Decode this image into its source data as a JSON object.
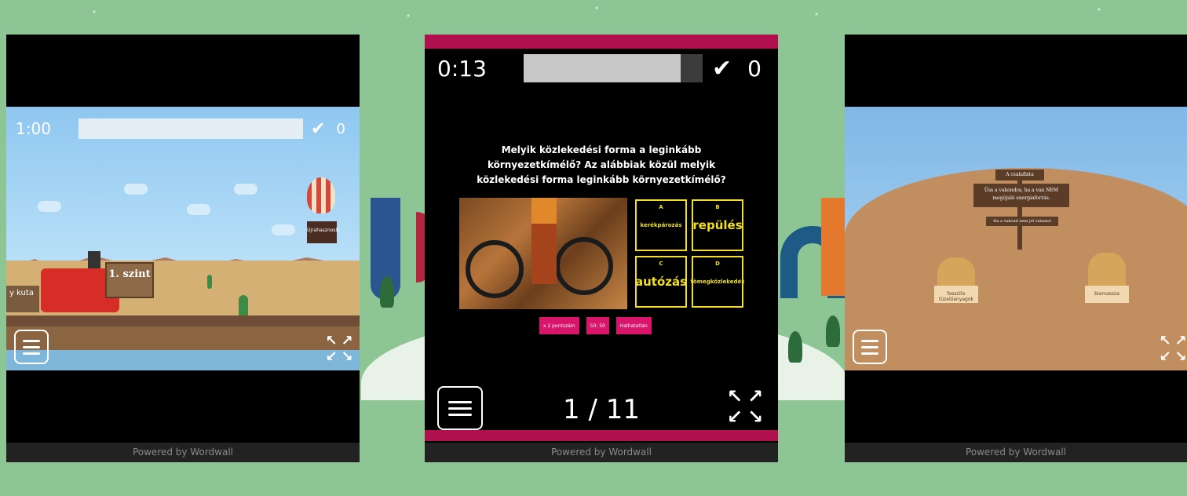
{
  "left": {
    "timer": "1:00",
    "score": "0",
    "level_sign": "1. szint",
    "wagon_label": "y kuta",
    "balloon_label": "Újrahasznosít",
    "powered": "Powered by Wordwall"
  },
  "middle": {
    "timer": "0:13",
    "score": "0",
    "question": "Melyik közlekedési forma a leginkább környezetkímélő? Az alábbiak közül melyik közlekedési forma leginkább környezetkímélő?",
    "answers": [
      {
        "letter": "A",
        "text": "kerékpározás"
      },
      {
        "letter": "B",
        "text": "repülés"
      },
      {
        "letter": "C",
        "text": "autózás"
      },
      {
        "letter": "D",
        "text": "tömegközlekedés"
      }
    ],
    "powerups": [
      "x 2 pontszám",
      "50: 50",
      "Halhatatlan"
    ],
    "pager": "1 / 11",
    "powered": "Powered by Wordwall"
  },
  "right": {
    "sign_title": "A csalafinta",
    "sign_text": "Üss a vakondra, ha a van NEM megújuló energiaforrás.",
    "sign_sub": "Ha a vakond nem jól válaszol",
    "mole1_label": "fosszilis tüzelőanyagok",
    "mole2_label": "biomassza",
    "powered": "Powered by Wordwall"
  },
  "colors": {
    "accent_pink": "#b0104e",
    "answer_yellow": "#f2df21",
    "powerup_pink": "#d8156b"
  }
}
